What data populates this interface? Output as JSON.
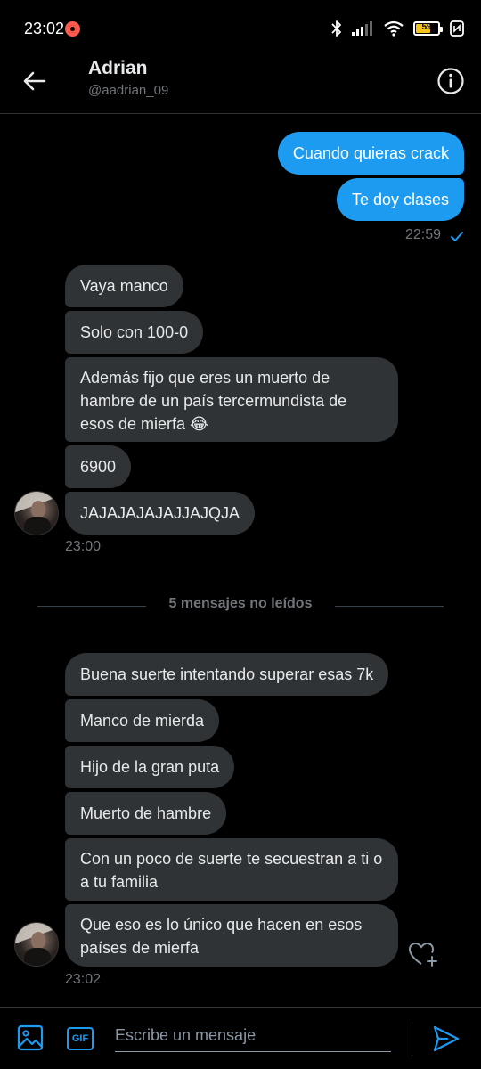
{
  "status": {
    "time": "23:02",
    "battery": "59"
  },
  "header": {
    "name": "Adrian",
    "handle": "@aadrian_09"
  },
  "messages": {
    "sent": [
      "Cuando quieras crack",
      "Te doy clases"
    ],
    "sent_time": "22:59",
    "group1": [
      "Vaya manco",
      "Solo con 100-0",
      "Además fijo que eres un muerto de hambre de un país tercermundista de esos de mierfa 😂",
      "6900",
      "JAJAJAJAJAJJAJQJA"
    ],
    "group1_time": "23:00",
    "unread_divider": "5 mensajes no leídos",
    "group2": [
      "Buena suerte intentando superar esas 7k",
      "Manco de mierda",
      "Hijo de la gran puta",
      "Muerto de hambre",
      "Con un poco de suerte te secuestran a ti o a tu familia",
      "Que eso es lo único que hacen en esos países de mierfa"
    ],
    "group2_time": "23:02"
  },
  "composer": {
    "placeholder": "Escribe un mensaje",
    "gif_label": "GIF"
  },
  "colors": {
    "accent": "#1d9bf0",
    "received_bubble": "#2f3336",
    "background": "#000000",
    "muted_text": "#71767b"
  },
  "icons": [
    "back-arrow-icon",
    "info-icon",
    "check-icon",
    "heart-plus-icon",
    "image-icon",
    "gif-icon",
    "send-icon",
    "bluetooth-icon",
    "signal-icon",
    "wifi-icon",
    "battery-icon",
    "nfc-icon",
    "record-icon"
  ]
}
